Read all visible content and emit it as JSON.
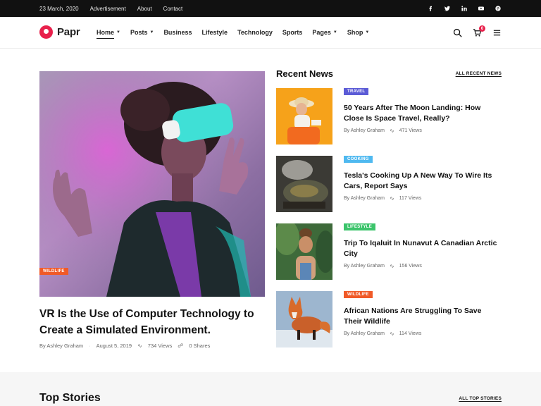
{
  "topbar": {
    "date": "23 March, 2020",
    "links": [
      "Advertisement",
      "About",
      "Contact"
    ],
    "social_icons": [
      "facebook-icon",
      "twitter-icon",
      "linkedin-icon",
      "youtube-icon",
      "pinterest-icon"
    ]
  },
  "nav": {
    "logo": "Papr",
    "menu": [
      {
        "label": "Home",
        "dropdown": true,
        "active": true
      },
      {
        "label": "Posts",
        "dropdown": true
      },
      {
        "label": "Business",
        "dropdown": false
      },
      {
        "label": "Lifestyle",
        "dropdown": false
      },
      {
        "label": "Technology",
        "dropdown": false
      },
      {
        "label": "Sports",
        "dropdown": false
      },
      {
        "label": "Pages",
        "dropdown": true
      },
      {
        "label": "Shop",
        "dropdown": true
      }
    ],
    "cart_count": "0",
    "icons": [
      "search-icon",
      "cart-icon",
      "hamburger-menu-icon"
    ]
  },
  "featured": {
    "category": "WILDLIFE",
    "title": "VR Is the Use of Computer Technology to Create a Simulated Environment.",
    "author": "By Ashley Graham",
    "date": "August 5, 2019",
    "views": "734 Views",
    "shares": "0 Shares"
  },
  "recent": {
    "heading": "Recent News",
    "all_link": "ALL RECENT NEWS",
    "items": [
      {
        "category": "TRAVEL",
        "color": "#5b5bd6",
        "title": "50 Years After The Moon Landing: How Close Is Space Travel, Really?",
        "author": "By Ashley Graham",
        "views": "471 Views"
      },
      {
        "category": "COOKING",
        "color": "#4fb9f0",
        "title": "Tesla's Cooking Up A New Way To Wire Its Cars, Report Says",
        "author": "By Ashley Graham",
        "views": "117 Views"
      },
      {
        "category": "LIFESTYLE",
        "color": "#3cc46b",
        "title": "Trip To Iqaluit In Nunavut A Canadian Arctic City",
        "author": "By Ashley Graham",
        "views": "156 Views"
      },
      {
        "category": "WILDLIFE",
        "color": "#f05a28",
        "title": "African Nations Are Struggling To Save Their Wildlife",
        "author": "By Ashley Graham",
        "views": "114 Views"
      }
    ]
  },
  "top_stories": {
    "heading": "Top Stories",
    "all_link": "ALL TOP STORIES"
  },
  "colors": {
    "brand": "#e8204b",
    "topbar_bg": "#111111",
    "wildlife": "#f05a28"
  }
}
